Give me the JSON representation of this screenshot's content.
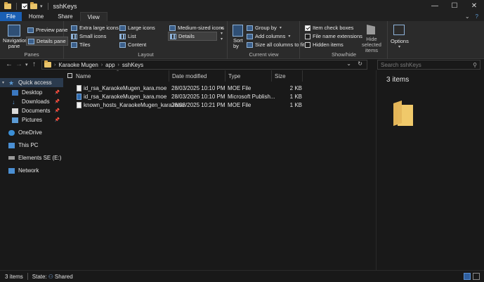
{
  "window": {
    "title": "sshKeys",
    "controls": {
      "minimize": "—",
      "maximize": "☐",
      "close": "✕"
    }
  },
  "ribbon_tabs": [
    {
      "label": "File"
    },
    {
      "label": "Home"
    },
    {
      "label": "Share"
    },
    {
      "label": "View"
    }
  ],
  "ribbon": {
    "panes": {
      "navigation_pane": "Navigation pane",
      "preview_pane": "Preview pane",
      "details_pane": "Details pane",
      "label": "Panes"
    },
    "layout": {
      "items": [
        "Extra large icons",
        "Large icons",
        "Medium-sized icons",
        "Small icons",
        "List",
        "Details",
        "Tiles",
        "Content"
      ],
      "label": "Layout"
    },
    "sort": {
      "label": "Sort by"
    },
    "current_view": {
      "group_by": "Group by",
      "add_columns": "Add columns",
      "size_all": "Size all columns to fit",
      "label": "Current view"
    },
    "show_hide": {
      "item_check_boxes": "Item check boxes",
      "file_name_extensions": "File name extensions",
      "hidden_items": "Hidden items",
      "hide_selected": "Hide selected items",
      "label": "Show/hide",
      "checked": {
        "item_check_boxes": true,
        "file_name_extensions": false,
        "hidden_items": false
      }
    },
    "options": {
      "label": "Options"
    }
  },
  "address": {
    "crumbs": [
      "Karaoke Mugen",
      "app",
      "sshKeys"
    ],
    "search_placeholder": "Search sshKeys"
  },
  "nav": [
    {
      "label": "Quick access",
      "icon": "star-icon",
      "selected": true
    },
    {
      "label": "Desktop",
      "icon": "desktop-icon",
      "pinned": true
    },
    {
      "label": "Downloads",
      "icon": "download-icon",
      "pinned": true
    },
    {
      "label": "Documents",
      "icon": "documents-icon",
      "pinned": true
    },
    {
      "label": "Pictures",
      "icon": "pictures-icon",
      "pinned": true
    },
    {
      "label": "OneDrive",
      "icon": "cloud-icon"
    },
    {
      "label": "This PC",
      "icon": "computer-icon"
    },
    {
      "label": "Elements SE (E:)",
      "icon": "drive-icon"
    },
    {
      "label": "Network",
      "icon": "network-icon"
    }
  ],
  "columns": [
    "Name",
    "Date modified",
    "Type",
    "Size"
  ],
  "files": [
    {
      "name": "id_rsa_KaraokeMugen_kara.moe",
      "date": "28/03/2025 10:10 PM",
      "type": "MOE File",
      "size": "2 KB",
      "icon": "file-icon"
    },
    {
      "name": "id_rsa_KaraokeMugen_kara.moe",
      "date": "28/03/2025 10:10 PM",
      "type": "Microsoft Publish...",
      "size": "1 KB",
      "icon": "publisher-icon"
    },
    {
      "name": "known_hosts_KaraokeMugen_kara.moe",
      "date": "28/03/2025 10:21 PM",
      "type": "MOE File",
      "size": "1 KB",
      "icon": "file-icon"
    }
  ],
  "preview": {
    "count": "3 items"
  },
  "status": {
    "items": "3 items",
    "state_label": "State:",
    "state_value": "Shared"
  }
}
